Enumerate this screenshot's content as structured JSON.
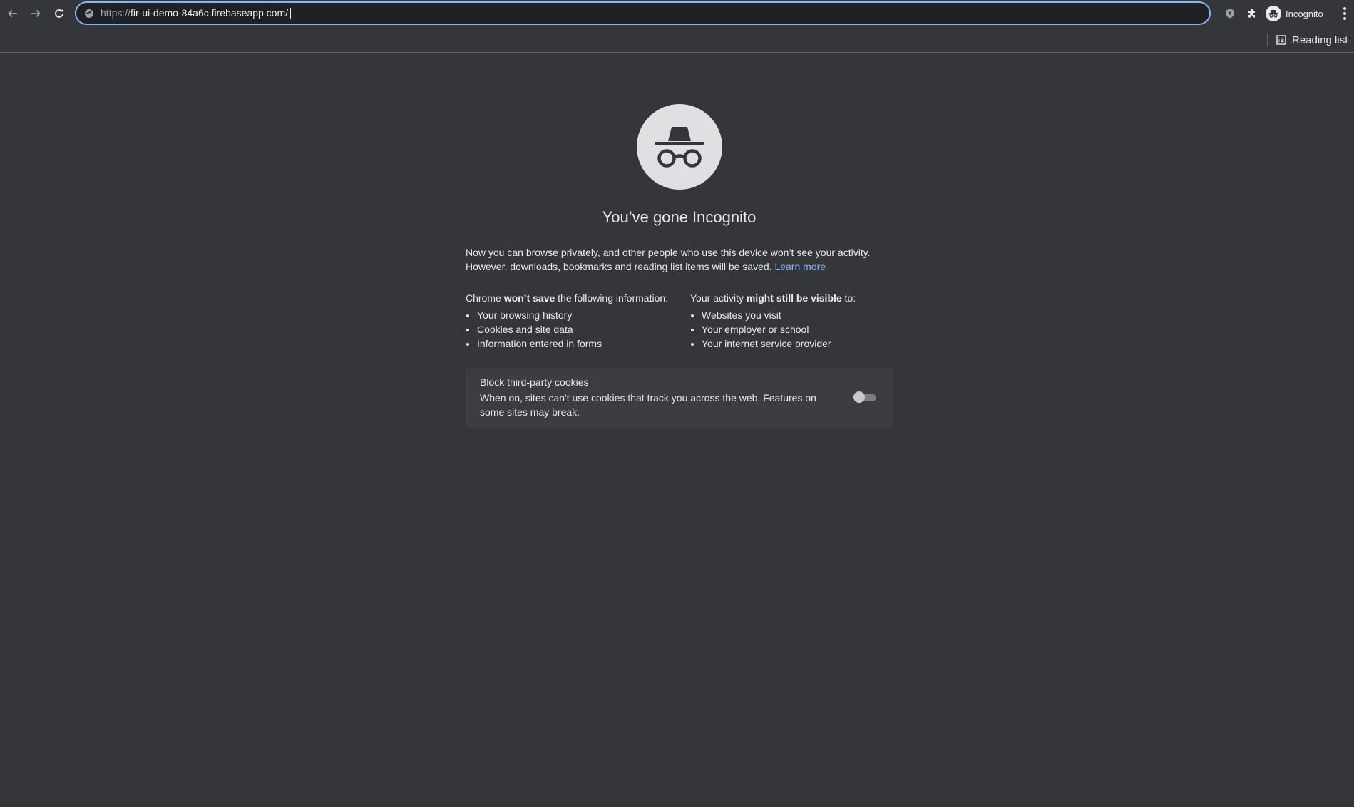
{
  "browser": {
    "address_bar": {
      "scheme": "https://",
      "host_and_path": "fir-ui-demo-84a6c.firebaseapp.com/"
    },
    "profile_label": "Incognito",
    "reading_list_label": "Reading list",
    "icons": [
      "back-arrow-icon",
      "forward-arrow-icon",
      "reload-icon",
      "site-info-icon",
      "shield-extension-icon",
      "puzzle-extension-icon",
      "incognito-avatar-icon",
      "more-vert-icon",
      "reading-list-icon"
    ]
  },
  "page": {
    "title": "You’ve gone Incognito",
    "intro_line1": "Now you can browse privately, and other people who use this device won’t see your activity.",
    "intro_line2": "However, downloads, bookmarks and reading list items will be saved.",
    "learn_more": "Learn more",
    "wont_save": {
      "prefix": "Chrome ",
      "bold": "won’t save",
      "suffix": " the following information:",
      "items": [
        "Your browsing history",
        "Cookies and site data",
        "Information entered in forms"
      ]
    },
    "might_be_visible": {
      "prefix": "Your activity ",
      "bold": "might still be visible",
      "suffix": " to:",
      "items": [
        "Websites you visit",
        "Your employer or school",
        "Your internet service provider"
      ]
    },
    "cookie_card": {
      "title": "Block third-party cookies",
      "description": "When on, sites can't use cookies that track you across the web. Features on some sites may break.",
      "toggle_on": false
    }
  },
  "colors": {
    "background": "#35363a",
    "omnibox_focus": "#8ab4f8",
    "link": "#8ab4f8",
    "card": "#3c3d41"
  }
}
